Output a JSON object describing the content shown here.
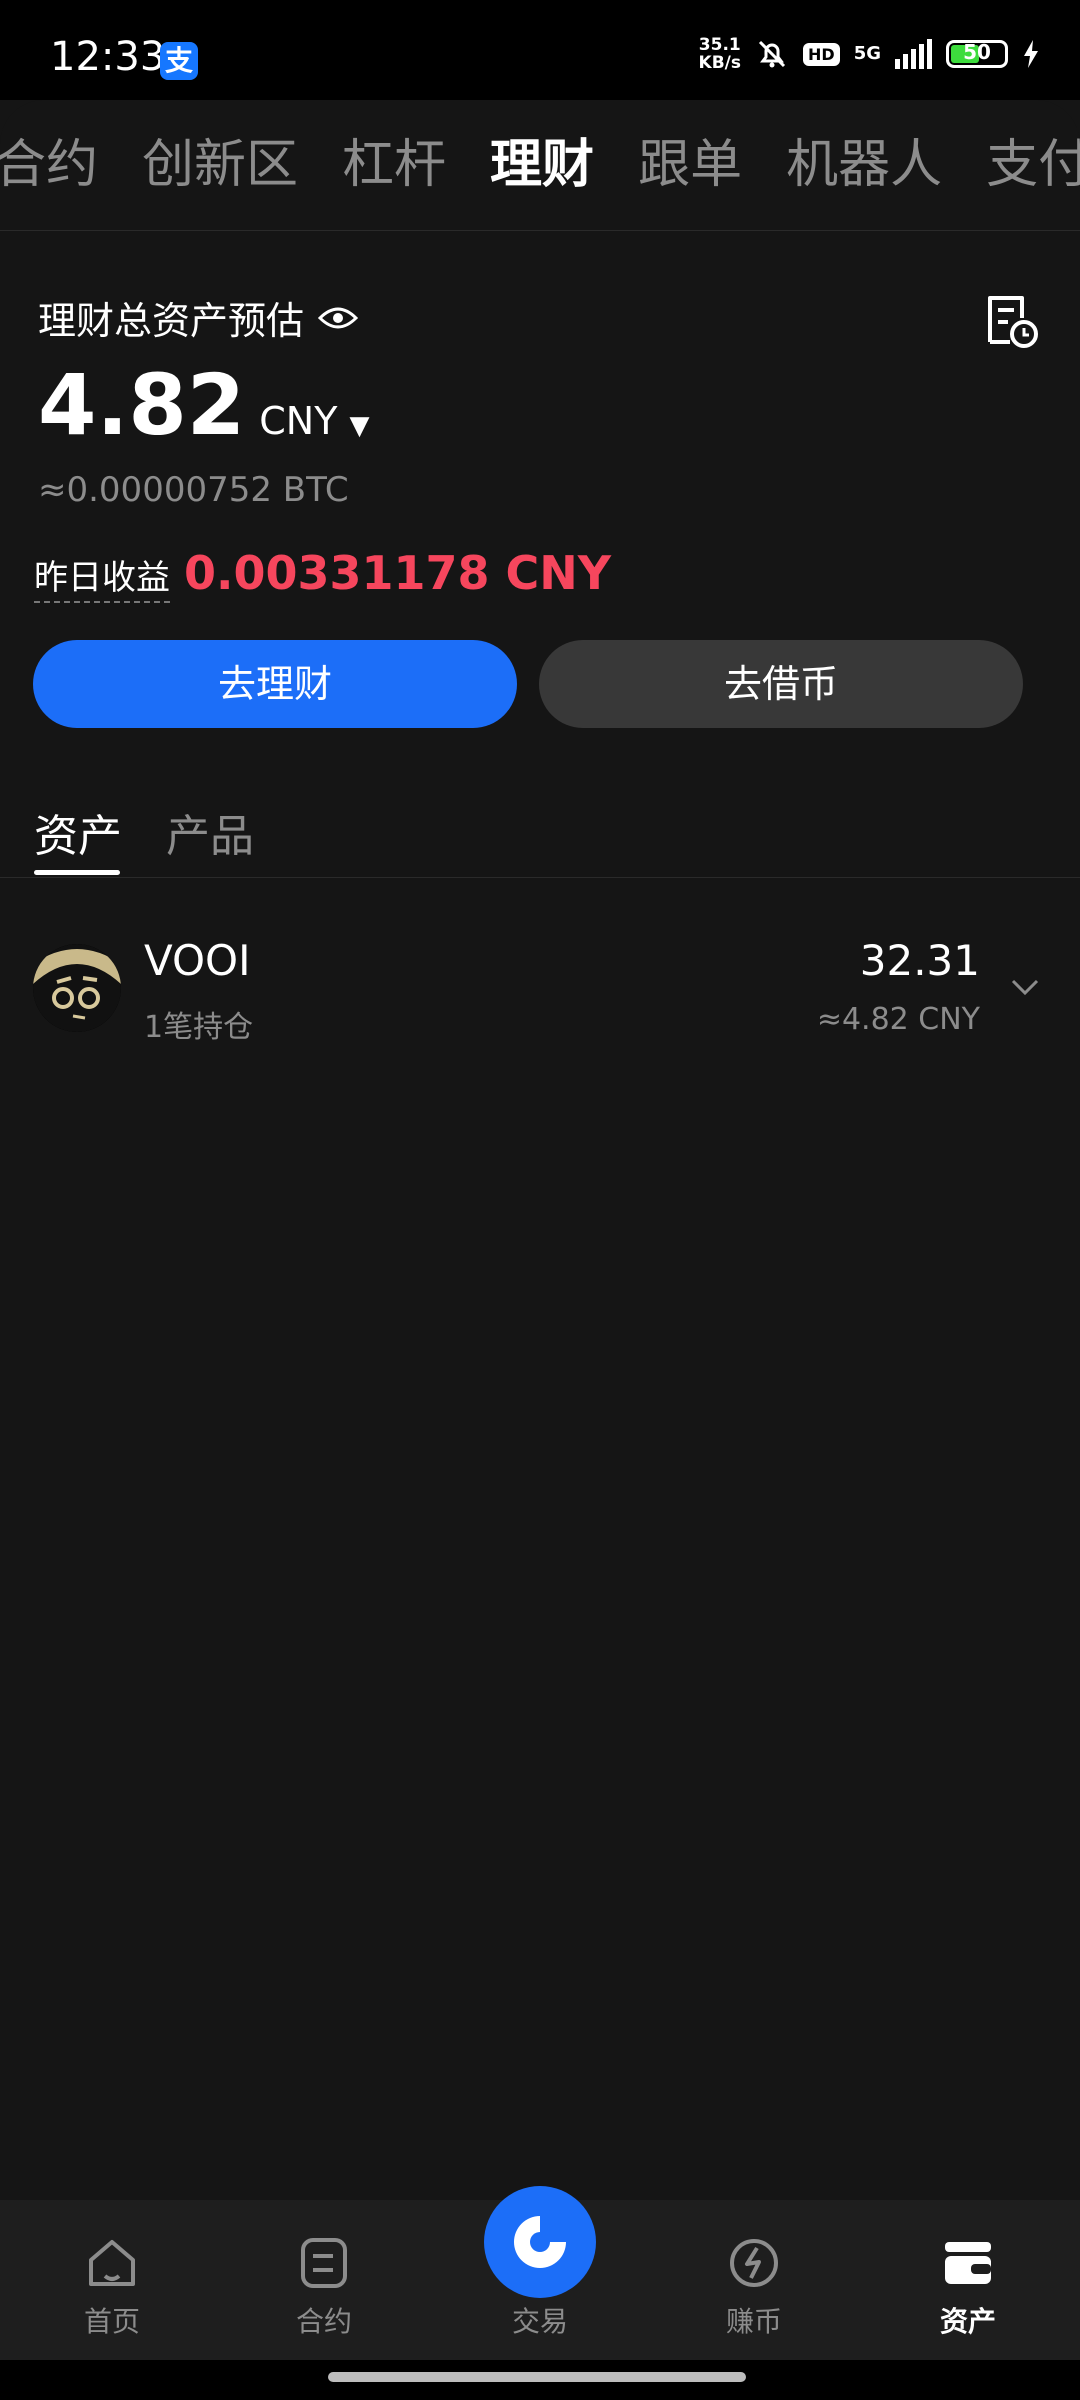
{
  "status_bar": {
    "time": "12:33",
    "app_badge": "支",
    "net_speed_top": "35.1",
    "net_speed_unit": "KB/s",
    "hd": "HD",
    "signal": "5G",
    "battery": "50"
  },
  "top_nav": {
    "tabs": [
      {
        "label": "合约"
      },
      {
        "label": "创新区"
      },
      {
        "label": "杠杆"
      },
      {
        "label": "理财"
      },
      {
        "label": "跟单"
      },
      {
        "label": "机器人"
      },
      {
        "label": "支付"
      }
    ],
    "active_index": 3
  },
  "summary": {
    "title": "理财总资产预估",
    "total_value": "4.82",
    "currency": "CNY",
    "btc_equiv": "≈0.00000752  BTC",
    "yesterday_label": "昨日收益",
    "yesterday_value": "0.00331178 CNY"
  },
  "actions": {
    "primary": "去理财",
    "secondary": "去借币"
  },
  "sub_tabs": {
    "assets": "资产",
    "products": "产品"
  },
  "holdings": [
    {
      "coin": "VOOI",
      "positions": "1笔持仓",
      "amount": "32.31",
      "cny": "≈4.82 CNY"
    }
  ],
  "tab_bar": {
    "home": "首页",
    "contract": "合约",
    "trade": "交易",
    "earn": "赚币",
    "assets": "资产"
  },
  "colors": {
    "accent": "#1c6ef8",
    "profit": "#f6465d",
    "background": "#151515"
  }
}
